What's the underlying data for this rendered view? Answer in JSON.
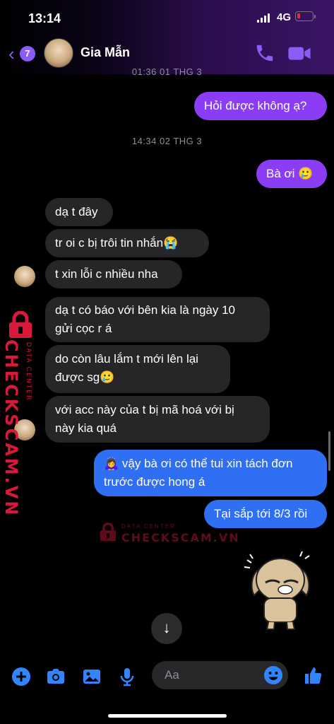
{
  "status_bar": {
    "time": "13:14",
    "network": "4G"
  },
  "header": {
    "back_badge": "7",
    "contact_name": "Gia Mẫn"
  },
  "messages": {
    "ts0": "01:36 01 THG 3",
    "m1": "Hỏi được không ạ?",
    "ts1": "14:34 02 THG 3",
    "m2": "Bà ơi 🥲",
    "m3": "dạ t đây",
    "m4": "tr oi c bị trôi tin nhắn😭",
    "m5": "t xin lỗi c nhiều nha",
    "m6a": "dạ t có báo với bên kia là ngày 10",
    "m6b": "gửi cọc r á",
    "m7a": "do còn lâu lắm t mới lên lại",
    "m7b": "được sg🥲",
    "m8a": "với acc này của t bị mã hoá với bị",
    "m8b": "này kia quá",
    "m9a": "🙇‍♀️ vậy bà ơi có thể tui xin tách đơn",
    "m9b": "trước được hong á",
    "m10": "Tại sắp tới 8/3 rồi"
  },
  "watermark": {
    "brand": "CHECKSCAM.VN",
    "tag": "DATA CENTER"
  },
  "composer": {
    "placeholder": "Aa"
  },
  "colors": {
    "outgoing": "#8b3df5",
    "outgoing_blue": "#2f6ff3",
    "incoming": "#262629",
    "accent": "#8b5cf6",
    "icons": "#2f86ff",
    "watermark": "#d8193a"
  }
}
